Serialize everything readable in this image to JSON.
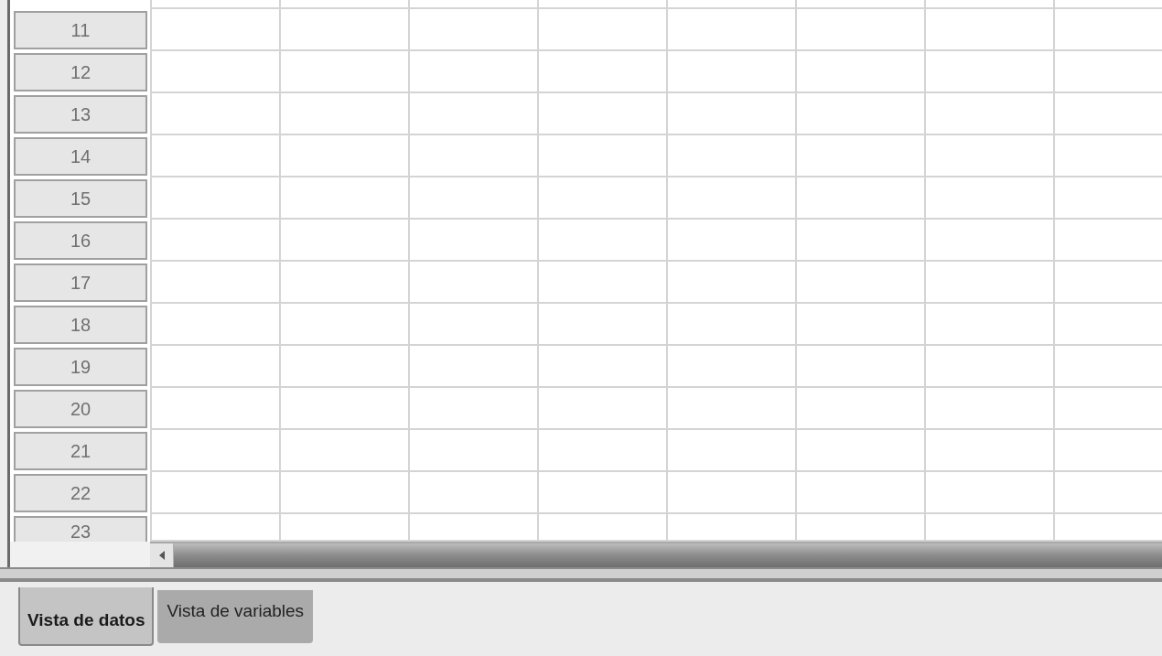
{
  "row_headers": [
    "11",
    "12",
    "13",
    "14",
    "15",
    "16",
    "17",
    "18",
    "19",
    "20",
    "21",
    "22",
    "23"
  ],
  "tabs": [
    {
      "label": "Vista de datos",
      "selected": true
    },
    {
      "label": "Vista de variables",
      "selected": false
    }
  ]
}
